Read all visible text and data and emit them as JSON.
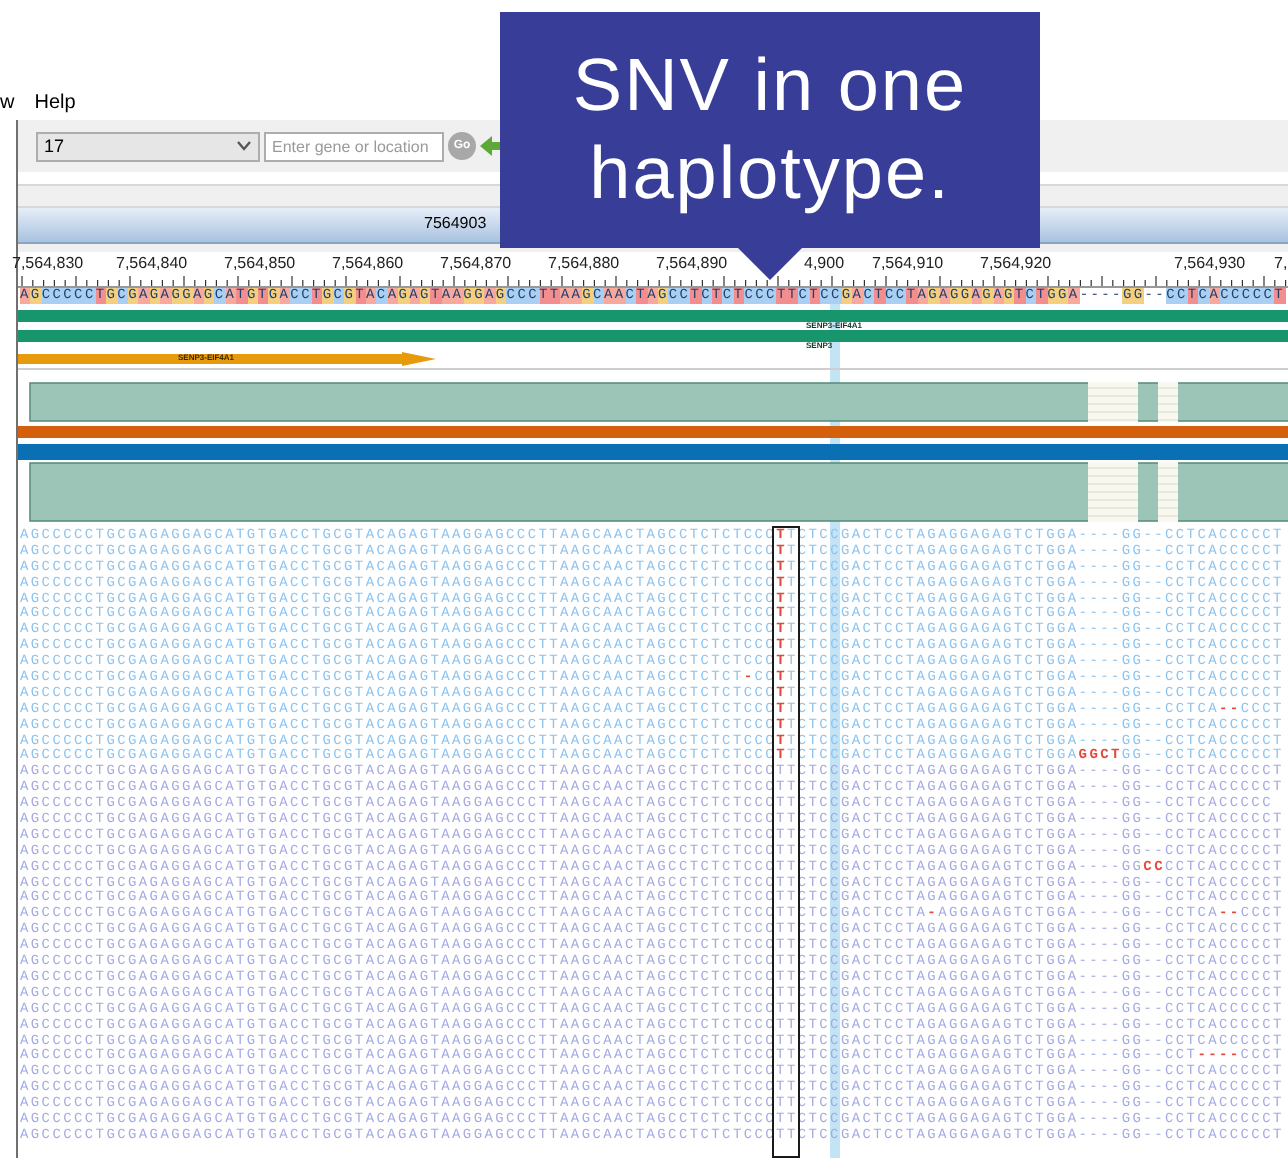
{
  "menu": [
    {
      "label": "w"
    },
    {
      "label": "Help"
    }
  ],
  "toolbar": {
    "chromosome": "17",
    "search": {
      "placeholder": "Enter gene or location"
    },
    "go": "Go"
  },
  "locus_bar": {
    "label": "7564903"
  },
  "callout": {
    "text": "SNV in one haplotype."
  },
  "ruler": {
    "ticks": [
      "7,564,830",
      "7,564,840",
      "7,564,850",
      "7,564,860",
      "7,564,870",
      "7,564,880",
      "7,564,890",
      "4,900",
      "7,564,910",
      "7,564,920",
      "7,564,930",
      "7,"
    ]
  },
  "reference": "AGCCCCCTGCGAGAGGAGCATGTGACCTGCGTACAGAGTAAGGAGCCCTTAAGCAACTAGCCTCTCTCCCTTCTCCGACTCCTAGAGGAGAGTCTGGA----GG--CCTCACCCCCT",
  "genes": [
    {
      "label": "SENP3-EIF4A1",
      "kind": "bar"
    },
    {
      "label": "SENP3",
      "kind": "bar"
    },
    {
      "label": "SENP3-EIF4A1",
      "kind": "arrow"
    }
  ],
  "reads": [
    {
      "color": "#8cc3ef",
      "segments": [
        {
          "text": "AGCCCCCTGCGAGAGGAGCATGTGACCTGCGTACAGAGTAAGGAGCCCTTAAGCAACTAGCCTCTCTCCC",
          "mismatch": false
        },
        {
          "text": "T",
          "mismatch": true
        },
        {
          "text": "TCTCCGACTCCTAGAGGAGAGTCTGGA----GG--CCTCACCCCCT",
          "mismatch": false
        }
      ]
    },
    {
      "color": "#8cc3ef",
      "segments": [
        {
          "text": "AGCCCCCTGCGAGAGGAGCATGTGACCTGCGTACAGAGTAAGGAGCCCTTAAGCAACTAGCCTCTCTCCC",
          "mismatch": false
        },
        {
          "text": "T",
          "mismatch": true
        },
        {
          "text": "TCTCCGACTCCTAGAGGAGAGTCTGGA----GG--CCTCACCCCCT",
          "mismatch": false
        }
      ]
    },
    {
      "color": "#8cc3ef",
      "segments": [
        {
          "text": "AGCCCCCTGCGAGAGGAGCATGTGACCTGCGTACAGAGTAAGGAGCCCTTAAGCAACTAGCCTCTCTCCC",
          "mismatch": false
        },
        {
          "text": "T",
          "mismatch": true
        },
        {
          "text": "TCTCCGACTCCTAGAGGAGAGTCTGGA----GG--CCTCACCCCCT",
          "mismatch": false
        }
      ]
    },
    {
      "color": "#8cc3ef",
      "segments": [
        {
          "text": "AGCCCCCTGCGAGAGGAGCATGTGACCTGCGTACAGAGTAAGGAGCCCTTAAGCAACTAGCCTCTCTCCC",
          "mismatch": false
        },
        {
          "text": "T",
          "mismatch": true
        },
        {
          "text": "TCTCCGACTCCTAGAGGAGAGTCTGGA----GG--CCTCACCCCCT",
          "mismatch": false
        }
      ]
    },
    {
      "color": "#8cc3ef",
      "segments": [
        {
          "text": "AGCCCCCTGCGAGAGGAGCATGTGACCTGCGTACAGAGTAAGGAGCCCTTAAGCAACTAGCCTCTCTCCC",
          "mismatch": false
        },
        {
          "text": "T",
          "mismatch": true
        },
        {
          "text": "TCTCCGACTCCTAGAGGAGAGTCTGGA----GG--CCTCACCCCCT",
          "mismatch": false
        }
      ]
    },
    {
      "color": "#8cc3ef",
      "segments": [
        {
          "text": "AGCCCCCTGCGAGAGGAGCATGTGACCTGCGTACAGAGTAAGGAGCCCTTAAGCAACTAGCCTCTCTCCC",
          "mismatch": false
        },
        {
          "text": "T",
          "mismatch": true
        },
        {
          "text": "TCTCCGACTCCTAGAGGAGAGTCTGGA----GG--CCTCACCCCCT",
          "mismatch": false
        }
      ]
    },
    {
      "color": "#8cc3ef",
      "segments": [
        {
          "text": "AGCCCCCTGCGAGAGGAGCATGTGACCTGCGTACAGAGTAAGGAGCCCTTAAGCAACTAGCCTCTCTCCC",
          "mismatch": false
        },
        {
          "text": "T",
          "mismatch": true
        },
        {
          "text": "TCTCCGACTCCTAGAGGAGAGTCTGGA----GG--CCTCACCCCCT",
          "mismatch": false
        }
      ]
    },
    {
      "color": "#8cc3ef",
      "segments": [
        {
          "text": "AGCCCCCTGCGAGAGGAGCATGTGACCTGCGTACAGAGTAAGGAGCCCTTAAGCAACTAGCCTCTCTCCC",
          "mismatch": false
        },
        {
          "text": "T",
          "mismatch": true
        },
        {
          "text": "TCTCCGACTCCTAGAGGAGAGTCTGGA----GG--CCTCACCCCCT",
          "mismatch": false
        }
      ]
    },
    {
      "color": "#8cc3ef",
      "segments": [
        {
          "text": "AGCCCCCTGCGAGAGGAGCATGTGACCTGCGTACAGAGTAAGGAGCCCTTAAGCAACTAGCCTCTCTCCC",
          "mismatch": false
        },
        {
          "text": "T",
          "mismatch": true
        },
        {
          "text": "TCTCCGACTCCTAGAGGAGAGTCTGGA----GG--CCTCACCCCCT",
          "mismatch": false
        }
      ]
    },
    {
      "color": "#8cc3ef",
      "segments": [
        {
          "text": "AGCCCCCTGCGAGAGGAGCATGTGACCTGCGTACAGAGTAAGGAGCCCTTAAGCAACTAGCCTCTCT",
          "mismatch": false
        },
        {
          "text": "-",
          "mismatch": true
        },
        {
          "text": "CC",
          "mismatch": false
        },
        {
          "text": "T",
          "mismatch": true
        },
        {
          "text": "TCTCCGACTCCTAGAGGAGAGTCTGGA----GG--CCTCACCCCCT",
          "mismatch": false
        }
      ]
    },
    {
      "color": "#8cc3ef",
      "segments": [
        {
          "text": "AGCCCCCTGCGAGAGGAGCATGTGACCTGCGTACAGAGTAAGGAGCCCTTAAGCAACTAGCCTCTCTCCC",
          "mismatch": false
        },
        {
          "text": "T",
          "mismatch": true
        },
        {
          "text": "TCTCCGACTCCTAGAGGAGAGTCTGGA----GG--CCTCACCCCCT",
          "mismatch": false
        }
      ]
    },
    {
      "color": "#8cc3ef",
      "segments": [
        {
          "text": "AGCCCCCTGCGAGAGGAGCATGTGACCTGCGTACAGAGTAAGGAGCCCTTAAGCAACTAGCCTCTCTCCC",
          "mismatch": false
        },
        {
          "text": "T",
          "mismatch": true
        },
        {
          "text": "TCTCCGACTCCTAGAGGAGAGTCTGGA----GG--CCTCA",
          "mismatch": false
        },
        {
          "text": "--",
          "mismatch": true
        },
        {
          "text": "CCCT",
          "mismatch": false
        }
      ]
    },
    {
      "color": "#8cc3ef",
      "segments": [
        {
          "text": "AGCCCCCTGCGAGAGGAGCATGTGACCTGCGTACAGAGTAAGGAGCCCTTAAGCAACTAGCCTCTCTCCC",
          "mismatch": false
        },
        {
          "text": "T",
          "mismatch": true
        },
        {
          "text": "TCTCCGACTCCTAGAGGAGAGTCTGGA----GG--CCTCACCCCCT",
          "mismatch": false
        }
      ]
    },
    {
      "color": "#8cc3ef",
      "segments": [
        {
          "text": "AGCCCCCTGCGAGAGGAGCATGTGACCTGCGTACAGAGTAAGGAGCCCTTAAGCAACTAGCCTCTCTCCC",
          "mismatch": false
        },
        {
          "text": "T",
          "mismatch": true
        },
        {
          "text": "TCTCCGACTCCTAGAGGAGAGTCTGGA----GG--CCTCACCCCCT",
          "mismatch": false
        }
      ]
    },
    {
      "color": "#8cc3ef",
      "segments": [
        {
          "text": "AGCCCCCTGCGAGAGGAGCATGTGACCTGCGTACAGAGTAAGGAGCCCTTAAGCAACTAGCCTCTCTCCC",
          "mismatch": false
        },
        {
          "text": "T",
          "mismatch": true
        },
        {
          "text": "TCTCCGACTCCTAGAGGAGAGTCTGGA",
          "mismatch": false
        },
        {
          "text": "GGCT",
          "mismatch": true
        },
        {
          "text": "GG--CCTCACCCCCT",
          "mismatch": false
        }
      ]
    },
    {
      "color": "#a3aae2",
      "segments": [
        {
          "text": "AGCCCCCTGCGAGAGGAGCATGTGACCTGCGTACAGAGTAAGGAGCCCTTAAGCAACTAGCCTCTCTCCCTTCTCCGACTCCTAGAGGAGAGTCTGGA----GG--CCTCACCCCCT",
          "mismatch": false
        }
      ]
    },
    {
      "color": "#a3aae2",
      "segments": [
        {
          "text": "AGCCCCCTGCGAGAGGAGCATGTGACCTGCGTACAGAGTAAGGAGCCCTTAAGCAACTAGCCTCTCTCCCTTCTCCGACTCCTAGAGGAGAGTCTGGA----GG--CCTCACCCCCT",
          "mismatch": false
        }
      ]
    },
    {
      "color": "#a3aae2",
      "segments": [
        {
          "text": "AGCCCCCTGCGAGAGGAGCATGTGACCTGCGTACAGAGTAAGGAGCCCTTAAGCAACTAGCCTCTCTCCCTTCTCCGACTCCTAGAGGAGAGTCTGGA----GG--CCTCACCCCC",
          "mismatch": false
        }
      ]
    },
    {
      "color": "#a3aae2",
      "segments": [
        {
          "text": "AGCCCCCTGCGAGAGGAGCATGTGACCTGCGTACAGAGTAAGGAGCCCTTAAGCAACTAGCCTCTCTCCCTTCTCCGACTCCTAGAGGAGAGTCTGGA----GG--CCTCACCCCCT",
          "mismatch": false
        }
      ]
    },
    {
      "color": "#a3aae2",
      "segments": [
        {
          "text": "AGCCCCCTGCGAGAGGAGCATGTGACCTGCGTACAGAGTAAGGAGCCCTTAAGCAACTAGCCTCTCTCCCTTCTCCGACTCCTAGAGGAGAGTCTGGA----GG--CCTCACCCCCT",
          "mismatch": false
        }
      ]
    },
    {
      "color": "#a3aae2",
      "segments": [
        {
          "text": "AGCCCCCTGCGAGAGGAGCATGTGACCTGCGTACAGAGTAAGGAGCCCTTAAGCAACTAGCCTCTCTCCCTTCTCCGACTCCTAGAGGAGAGTCTGGA----GG--CCTCACCCCCT",
          "mismatch": false
        }
      ]
    },
    {
      "color": "#a3aae2",
      "segments": [
        {
          "text": "AGCCCCCTGCGAGAGGAGCATGTGACCTGCGTACAGAGTAAGGAGCCCTTAAGCAACTAGCCTCTCTCCCTTCTCCGACTCCTAGAGGAGAGTCTGGA----GG",
          "mismatch": false
        },
        {
          "text": "CC",
          "mismatch": true
        },
        {
          "text": "CCTCACCCCCT",
          "mismatch": false
        }
      ]
    },
    {
      "color": "#a3aae2",
      "segments": [
        {
          "text": "AGCCCCCTGCGAGAGGAGCATGTGACCTGCGTACAGAGTAAGGAGCCCTTAAGCAACTAGCCTCTCTCCCTTCTCCGACTCCTAGAGGAGAGTCTGGA----GG--CCTCACCCCCT",
          "mismatch": false
        }
      ]
    },
    {
      "color": "#a3aae2",
      "segments": [
        {
          "text": "AGCCCCCTGCGAGAGGAGCATGTGACCTGCGTACAGAGTAAGGAGCCCTTAAGCAACTAGCCTCTCTCCCTTCTCCGACTCCTAGAGGAGAGTCTGGA----GG--CCTCACCCCCT",
          "mismatch": false
        }
      ]
    },
    {
      "color": "#a3aae2",
      "segments": [
        {
          "text": "AGCCCCCTGCGAGAGGAGCATGTGACCTGCGTACAGAGTAAGGAGCCCTTAAGCAACTAGCCTCTCTCCCTTCTCCGACTCCTA",
          "mismatch": false
        },
        {
          "text": "-",
          "mismatch": true
        },
        {
          "text": "AGGAGAGTCTGGA----GG--CCTCA",
          "mismatch": false
        },
        {
          "text": "--",
          "mismatch": true
        },
        {
          "text": "CCCT",
          "mismatch": false
        }
      ]
    },
    {
      "color": "#a3aae2",
      "segments": [
        {
          "text": "AGCCCCCTGCGAGAGGAGCATGTGACCTGCGTACAGAGTAAGGAGCCCTTAAGCAACTAGCCTCTCTCCCTTCTCCGACTCCTAGAGGAGAGTCTGGA----GG--CCTCACCCCCT",
          "mismatch": false
        }
      ]
    },
    {
      "color": "#a3aae2",
      "segments": [
        {
          "text": "AGCCCCCTGCGAGAGGAGCATGTGACCTGCGTACAGAGTAAGGAGCCCTTAAGCAACTAGCCTCTCTCCCTTCTCCGACTCCTAGAGGAGAGTCTGGA----GG--CCTCACCCCCT",
          "mismatch": false
        }
      ]
    },
    {
      "color": "#a3aae2",
      "segments": [
        {
          "text": "AGCCCCCTGCGAGAGGAGCATGTGACCTGCGTACAGAGTAAGGAGCCCTTAAGCAACTAGCCTCTCTCCCTTCTCCGACTCCTAGAGGAGAGTCTGGA----GG--CCTCACCCCCT",
          "mismatch": false
        }
      ]
    },
    {
      "color": "#a3aae2",
      "segments": [
        {
          "text": "AGCCCCCTGCGAGAGGAGCATGTGACCTGCGTACAGAGTAAGGAGCCCTTAAGCAACTAGCCTCTCTCCCTTCTCCGACTCCTAGAGGAGAGTCTGGA----GG--CCTCACCCCCT",
          "mismatch": false
        }
      ]
    },
    {
      "color": "#a3aae2",
      "segments": [
        {
          "text": "AGCCCCCTGCGAGAGGAGCATGTGACCTGCGTACAGAGTAAGGAGCCCTTAAGCAACTAGCCTCTCTCCCTTCTCCGACTCCTAGAGGAGAGTCTGGA----GG--CCTCACCCCCT",
          "mismatch": false
        }
      ]
    },
    {
      "color": "#a3aae2",
      "segments": [
        {
          "text": "AGCCCCCTGCGAGAGGAGCATGTGACCTGCGTACAGAGTAAGGAGCCCTTAAGCAACTAGCCTCTCTCCCTTCTCCGACTCCTAGAGGAGAGTCTGGA----GG--CCTCACCCCCT",
          "mismatch": false
        }
      ]
    },
    {
      "color": "#a3aae2",
      "segments": [
        {
          "text": "AGCCCCCTGCGAGAGGAGCATGTGACCTGCGTACAGAGTAAGGAGCCCTTAAGCAACTAGCCTCTCTCCCTTCTCCGACTCCTAGAGGAGAGTCTGGA----GG--CCTCACCCCCT",
          "mismatch": false
        }
      ]
    },
    {
      "color": "#a3aae2",
      "segments": [
        {
          "text": "AGCCCCCTGCGAGAGGAGCATGTGACCTGCGTACAGAGTAAGGAGCCCTTAAGCAACTAGCCTCTCTCCCTTCTCCGACTCCTAGAGGAGAGTCTGGA----GG--CCTCACCCCCT",
          "mismatch": false
        }
      ]
    },
    {
      "color": "#a3aae2",
      "segments": [
        {
          "text": "AGCCCCCTGCGAGAGGAGCATGTGACCTGCGTACAGAGTAAGGAGCCCTTAAGCAACTAGCCTCTCTCCCTTCTCCGACTCCTAGAGGAGAGTCTGGA----GG--CCT",
          "mismatch": false
        },
        {
          "text": "----",
          "mismatch": true
        },
        {
          "text": "CCCT",
          "mismatch": false
        }
      ]
    },
    {
      "color": "#a3aae2",
      "segments": [
        {
          "text": "AGCCCCCTGCGAGAGGAGCATGTGACCTGCGTACAGAGTAAGGAGCCCTTAAGCAACTAGCCTCTCTCCCTTCTCCGACTCCTAGAGGAGAGTCTGGA----GG--CCTCACCCCCT",
          "mismatch": false
        }
      ]
    },
    {
      "color": "#a3aae2",
      "segments": [
        {
          "text": "AGCCCCCTGCGAGAGGAGCATGTGACCTGCGTACAGAGTAAGGAGCCCTTAAGCAACTAGCCTCTCTCCCTTCTCCGACTCCTAGAGGAGAGTCTGGA----GG--CCTCACCCCCT",
          "mismatch": false
        }
      ]
    },
    {
      "color": "#a3aae2",
      "segments": [
        {
          "text": "AGCCCCCTGCGAGAGGAGCATGTGACCTGCGTACAGAGTAAGGAGCCCTTAAGCAACTAGCCTCTCTCCCTTCTCCGACTCCTAGAGGAGAGTCTGGA----GG--CCTCACCCCCT",
          "mismatch": false
        }
      ]
    },
    {
      "color": "#a3aae2",
      "segments": [
        {
          "text": "AGCCCCCTGCGAGAGGAGCATGTGACCTGCGTACAGAGTAAGGAGCCCTTAAGCAACTAGCCTCTCTCCCTTCTCCGACTCCTAGAGGAGAGTCTGGA----GG--CCTCACCCCCT",
          "mismatch": false
        }
      ]
    },
    {
      "color": "#a3aae2",
      "segments": [
        {
          "text": "AGCCCCCTGCGAGAGGAGCATGTGACCTGCGTACAGAGTAAGGAGCCCTTAAGCAACTAGCCTCTCTCCCTTCTCCGACTCCTAGAGGAGAGTCTGGA----GG--CCTCACCCCCT",
          "mismatch": false
        }
      ]
    }
  ]
}
